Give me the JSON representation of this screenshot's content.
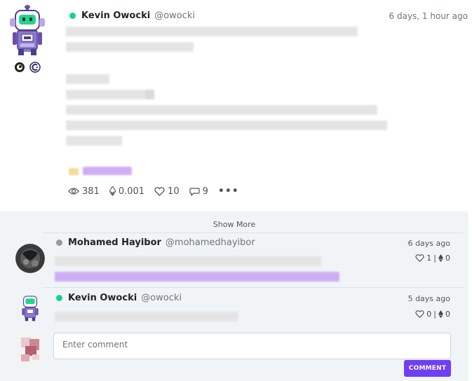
{
  "post": {
    "author_name": "Kevin Owocki",
    "author_handle": "@owocki",
    "timestamp": "6 days, 1 hour ago",
    "status_color": "#11d68a",
    "stats": {
      "views": "381",
      "tips": "0.001",
      "likes": "10",
      "comments": "9"
    }
  },
  "comments": {
    "show_more_label": "Show More",
    "items": [
      {
        "author_name": "Mohamed Hayibor",
        "author_handle": "@mohamedhayibor",
        "timestamp": "6 days ago",
        "status_color": "#999999",
        "likes": "1",
        "tips": "0"
      },
      {
        "author_name": "Kevin Owocki",
        "author_handle": "@owocki",
        "timestamp": "5 days ago",
        "status_color": "#11d68a",
        "likes": "0",
        "tips": "0"
      }
    ],
    "input_placeholder": "Enter comment",
    "submit_label": "COMMENT"
  },
  "colors": {
    "accent": "#6f3ff5",
    "online": "#11d68a",
    "offline": "#999999"
  }
}
